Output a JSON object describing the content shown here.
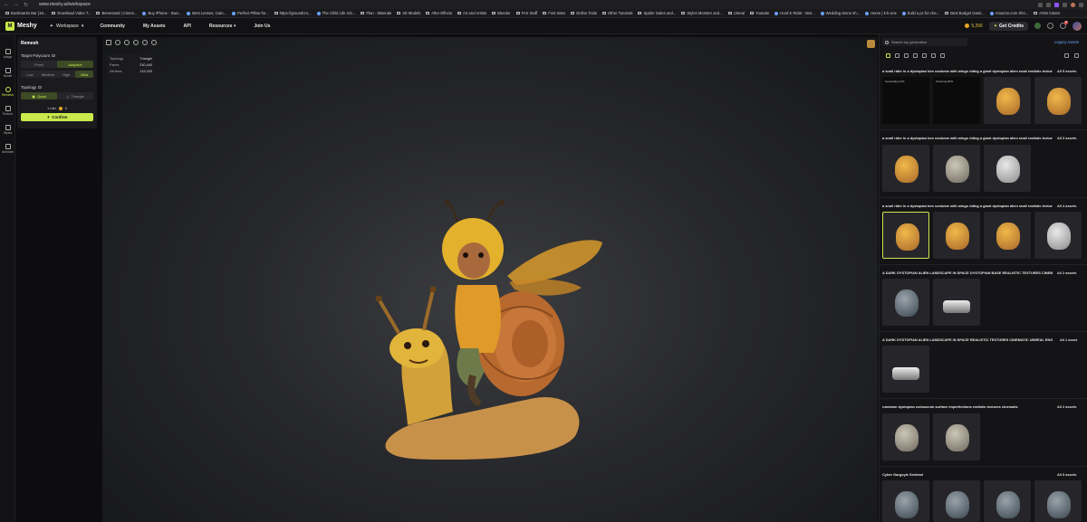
{
  "browser": {
    "url": "www.meshy.ai/workspace",
    "bookmarks": [
      "Bookmarks Bar (18...",
      "Download Video T...",
      "Bemesand | Cinem...",
      "Buy iPhone - Swa...",
      "Best Lenses, Cam...",
      "Perfect Pillow for...",
      "https://groundcro...",
      "The Child Life Giz...",
      "Plan - Miserale",
      "3D Models",
      "After Effects",
      "Art and Artists",
      "Blender",
      "FAX Stuff",
      "Font Sites",
      "Online Tools",
      "Other Tutorials",
      "Spider Gales and...",
      "Styles Monster and...",
      "Unreal",
      "Youtube",
      "Hurd K Ridar - Mor...",
      "Wedding drone sh...",
      "Home | k-b-one",
      "build a pc for che...",
      "Best Budget Gami...",
      "Amazon.com Sho...",
      "Artist Cstars"
    ]
  },
  "header": {
    "logo_text": "Meshy",
    "workspace_label": "Workspace",
    "nav": [
      "Community",
      "My Assets",
      "API",
      "Resources",
      "Join Us"
    ],
    "credits": "5,266",
    "get_credits": "Get Credits",
    "notif_count": "99"
  },
  "rail": [
    "Image",
    "Model",
    "Remesh",
    "Texture",
    "Styles",
    "Animate"
  ],
  "remesh": {
    "title": "Remesh",
    "target_label": "Target Polycount",
    "mode_options": [
      "Fixed",
      "Adaptive"
    ],
    "density_options": [
      "Low",
      "Medium",
      "High",
      "Ultra"
    ],
    "topology_label": "Topology",
    "topology_options": [
      "Quad",
      "Triangle"
    ],
    "eta": "1 min",
    "cost": "0",
    "confirm": "Confirm"
  },
  "stats": [
    {
      "k": "Topology",
      "v": "Triangle"
    },
    {
      "k": "Faces",
      "v": "230,440"
    },
    {
      "k": "Vertices",
      "v": "115,200"
    }
  ],
  "sidebar": {
    "search_placeholder": "Search my generation",
    "legacy": "Legacy Assets",
    "groups": [
      {
        "title": "a snail rider in a dystopian bee costume with wings riding a giant dystopian alien snail realistic textures re...",
        "all": "All 5 assets",
        "thumbs": [
          "Generating 11%",
          "Texturing 60%"
        ]
      },
      {
        "title": "a snail rider in a dystopian bee costume with wings riding a giant dystopian alien snail realistic textures re...",
        "all": "All 3 assets"
      },
      {
        "title": "a snail rider in a dystopian bee costume with wings riding a giant dystopian alien snail realistic textures re...",
        "all": "All 4 assets"
      },
      {
        "title": "A DARK DYSTOPIAN ALIEN LANDSCAPE IN SPACE DYSTOPIAN BASE REALISTIC TEXTURES CINEMATIC UN...",
        "all": "All 2 assets"
      },
      {
        "title": "A DARK DYSTOPIAN ALIEN LANDSCAPE IN SPACE REALISTIC TEXTURES CINEMATIC UNREAL ENGINE",
        "all": "All 1 asset"
      },
      {
        "title": "rundown dystopian colosseum surface imperfections realistic textures cinematic",
        "all": "All 2 assets"
      },
      {
        "title": "Cyber Gargoyle Sentinel",
        "all": "All 5 assets"
      }
    ]
  },
  "colors": {
    "accent": "#c9e94c",
    "link": "#6ea4ff"
  }
}
